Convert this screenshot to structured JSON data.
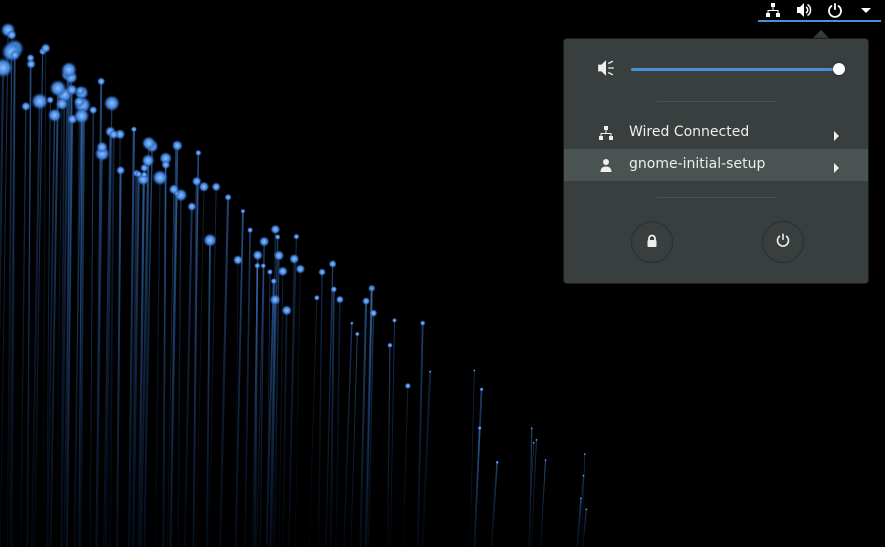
{
  "topbar": {
    "icons": [
      "network-wired-icon",
      "audio-volume-icon",
      "power-icon",
      "menu-dropdown-icon"
    ]
  },
  "menu": {
    "volume": {
      "level": 1.0,
      "icon": "audio-volume-muted-icon"
    },
    "items": [
      {
        "label": "Wired Connected",
        "icon": "network-wired-icon"
      },
      {
        "label": "gnome-initial-setup",
        "icon": "user-icon"
      }
    ],
    "buttons": [
      "lock-icon",
      "power-off-icon"
    ]
  },
  "colors": {
    "accent": "#4a90d9",
    "menu_bg": "#393f3f",
    "hover_bg": "#4a5252"
  }
}
